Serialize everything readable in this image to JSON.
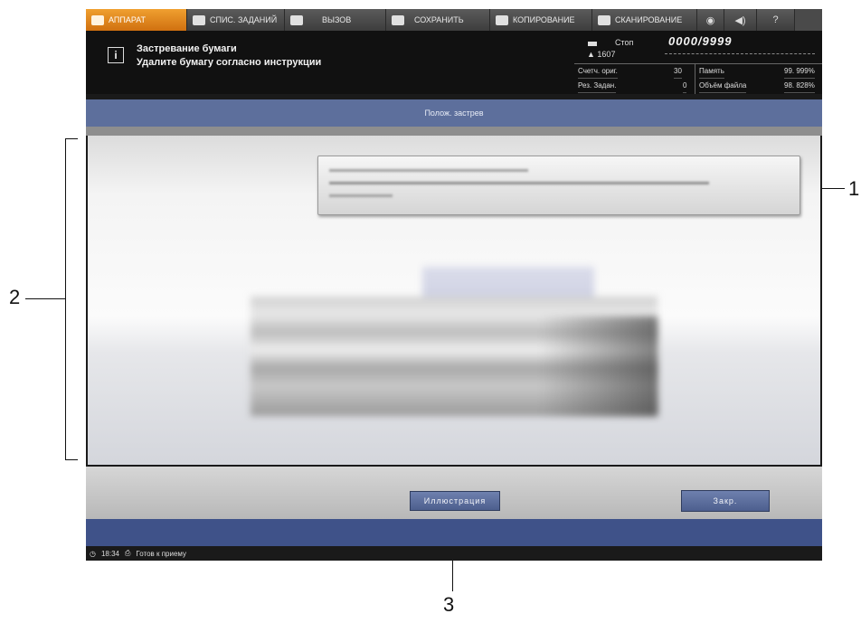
{
  "tabs": [
    {
      "id": "machine",
      "label": "АППАРАТ",
      "active": true
    },
    {
      "id": "jobs",
      "label": "СПИС. ЗАДАНИЙ"
    },
    {
      "id": "recall",
      "label": "ВЫЗОВ"
    },
    {
      "id": "store",
      "label": "СОХРАНИТЬ"
    },
    {
      "id": "copy",
      "label": "КОПИРОВАНИЕ"
    },
    {
      "id": "scan",
      "label": "СКАНИРОВАНИЕ"
    }
  ],
  "tab_icons": {
    "volume": "speaker-icon",
    "help": "?"
  },
  "message": {
    "line1": "Застревание бумаги",
    "line2": "Удалите бумагу согласно инструкции",
    "icon": "i"
  },
  "status": {
    "stop_label": "Стоп",
    "counter": "0000/9999",
    "user_count": "1607",
    "orig_counter_label": "Счетч. ориг.",
    "orig_counter_value": "30",
    "memory_label": "Память",
    "memory_value": "99. 999%",
    "reserved_label": "Рез. Задан.",
    "reserved_value": "0",
    "file_volume_label": "Объём файла",
    "file_volume_value": "98. 828%"
  },
  "title": "Полож. застрев",
  "buttons": {
    "illustration": "Иллюстрация",
    "close": "Закр."
  },
  "footer": {
    "time": "18:34",
    "status": "Готов к приему"
  },
  "callouts": {
    "c1": "1",
    "c2": "2",
    "c3": "3"
  },
  "colors": {
    "accent_tab": "#e8901f",
    "title_bar": "#5d6f9c",
    "button": "#5a6c9b",
    "blue_bar": "#3f5289"
  }
}
